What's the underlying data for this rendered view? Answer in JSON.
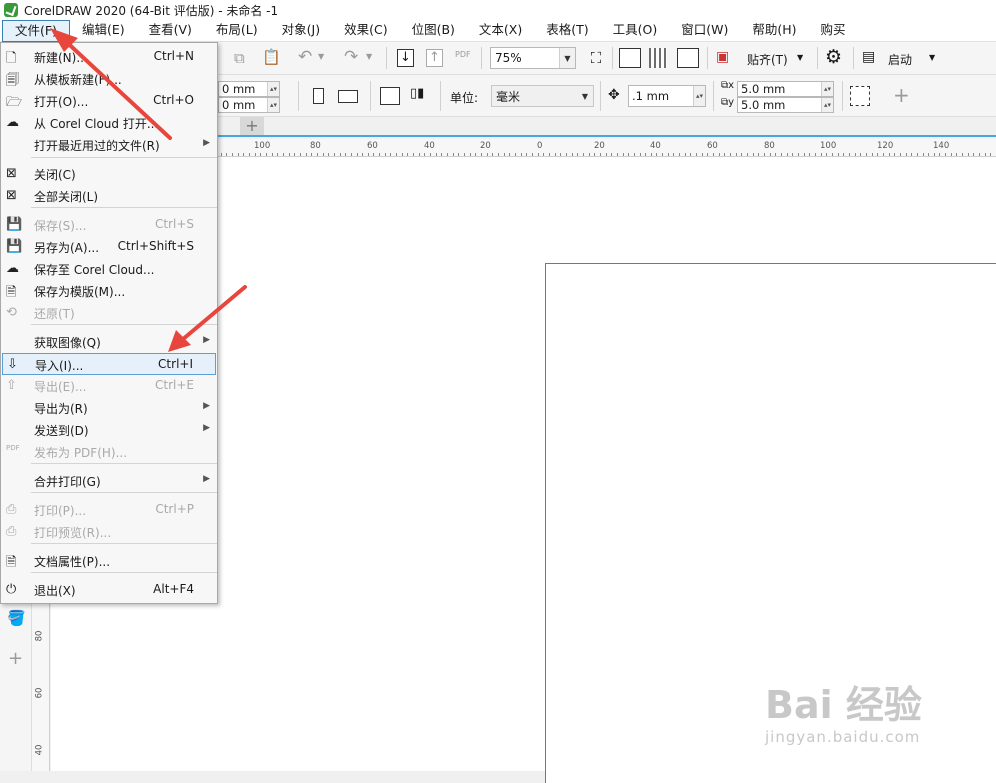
{
  "window": {
    "title": "CorelDRAW 2020 (64-Bit 评估版) - 未命名 -1"
  },
  "menubar": {
    "items": [
      "文件(F)",
      "编辑(E)",
      "查看(V)",
      "布局(L)",
      "对象(J)",
      "效果(C)",
      "位图(B)",
      "文本(X)",
      "表格(T)",
      "工具(O)",
      "窗口(W)",
      "帮助(H)",
      "购买"
    ]
  },
  "toolbar1": {
    "zoom_value": "75%",
    "snap_label": "贴齐(T)",
    "launch_label": "启动",
    "pdf_label": "PDF"
  },
  "toolbar2": {
    "width_value": "0 mm",
    "height_value": "0 mm",
    "units_label": "单位:",
    "units_value": "毫米",
    "nudge_value": ".1 mm",
    "dup_x": "5.0 mm",
    "dup_y": "5.0 mm"
  },
  "ruler": {
    "h_labels": [
      "100",
      "80",
      "60",
      "40",
      "20",
      "0",
      "20",
      "40",
      "60",
      "80",
      "100",
      "120",
      "140"
    ],
    "v_labels": [
      "80",
      "60",
      "40"
    ]
  },
  "file_menu": {
    "items": [
      {
        "label": "新建(N)...",
        "shortcut": "Ctrl+N",
        "icon": "new-doc-icon",
        "enabled": true
      },
      {
        "label": "从模板新建(F)...",
        "shortcut": "",
        "icon": "template-new-icon",
        "enabled": true
      },
      {
        "label": "打开(O)...",
        "shortcut": "Ctrl+O",
        "icon": "open-folder-icon",
        "enabled": true
      },
      {
        "label": "从 Corel Cloud 打开...",
        "shortcut": "",
        "icon": "cloud-open-icon",
        "enabled": true
      },
      {
        "label": "打开最近用过的文件(R)",
        "shortcut": "",
        "icon": "",
        "enabled": true,
        "submenu": true
      },
      {
        "label": "关闭(C)",
        "shortcut": "",
        "icon": "close-doc-icon",
        "enabled": true
      },
      {
        "label": "全部关闭(L)",
        "shortcut": "",
        "icon": "close-all-icon",
        "enabled": true
      },
      {
        "label": "保存(S)...",
        "shortcut": "Ctrl+S",
        "icon": "save-icon",
        "enabled": false
      },
      {
        "label": "另存为(A)...",
        "shortcut": "Ctrl+Shift+S",
        "icon": "save-as-icon",
        "enabled": true
      },
      {
        "label": "保存至 Corel Cloud...",
        "shortcut": "",
        "icon": "cloud-save-icon",
        "enabled": true
      },
      {
        "label": "保存为模版(M)...",
        "shortcut": "",
        "icon": "save-template-icon",
        "enabled": true
      },
      {
        "label": "还原(T)",
        "shortcut": "",
        "icon": "revert-icon",
        "enabled": false
      },
      {
        "label": "获取图像(Q)",
        "shortcut": "",
        "icon": "",
        "enabled": true,
        "submenu": true
      },
      {
        "label": "导入(I)...",
        "shortcut": "Ctrl+I",
        "icon": "import-icon",
        "enabled": true,
        "highlight": true
      },
      {
        "label": "导出(E)...",
        "shortcut": "Ctrl+E",
        "icon": "export-icon",
        "enabled": false
      },
      {
        "label": "导出为(R)",
        "shortcut": "",
        "icon": "",
        "enabled": true,
        "submenu": true
      },
      {
        "label": "发送到(D)",
        "shortcut": "",
        "icon": "",
        "enabled": true,
        "submenu": true
      },
      {
        "label": "发布为 PDF(H)...",
        "shortcut": "",
        "icon": "pdf-icon",
        "enabled": false
      },
      {
        "label": "合并打印(G)",
        "shortcut": "",
        "icon": "",
        "enabled": true,
        "submenu": true
      },
      {
        "label": "打印(P)...",
        "shortcut": "Ctrl+P",
        "icon": "print-icon",
        "enabled": false
      },
      {
        "label": "打印预览(R)...",
        "shortcut": "",
        "icon": "print-preview-icon",
        "enabled": false
      },
      {
        "label": "文档属性(P)...",
        "shortcut": "",
        "icon": "doc-properties-icon",
        "enabled": true
      },
      {
        "label": "退出(X)",
        "shortcut": "Alt+F4",
        "icon": "power-icon",
        "enabled": true
      }
    ]
  },
  "watermark": {
    "logo": "Bai 经验",
    "sub": "jingyan.baidu.com"
  },
  "colors": {
    "accent": "#3c7fb1",
    "highlight_bg": "#e6f0fa",
    "arrow": "#e8453c"
  }
}
